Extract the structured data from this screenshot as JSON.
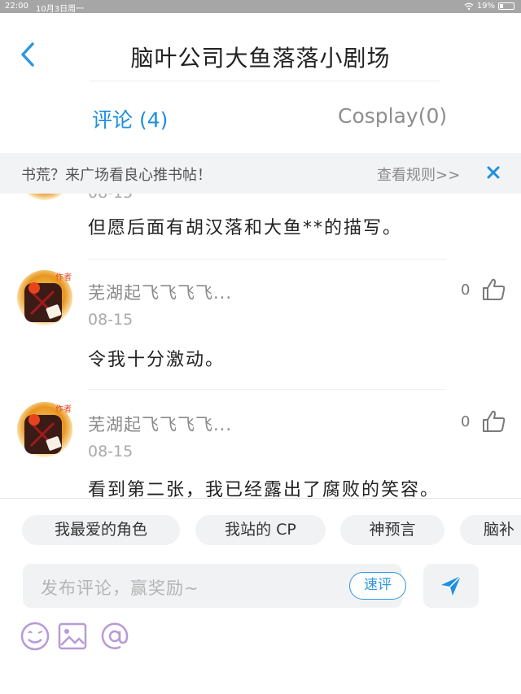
{
  "status_bar": {
    "time": "22:00",
    "date": "10月3日周一",
    "battery": "19%"
  },
  "header": {
    "title": "脑叶公司大鱼落落小剧场"
  },
  "tabs": [
    {
      "label": "评论 (4)",
      "active": true
    },
    {
      "label": "Cosplay(0)",
      "active": false
    }
  ],
  "notice": {
    "text": "书荒？来广场看良心推书帖！",
    "link": "查看规则>>"
  },
  "comments": [
    {
      "date": "08-15",
      "text": "但愿后面有胡汉落和大鱼**的描写。"
    },
    {
      "user": "芜湖起飞飞飞飞...",
      "badge": "作者",
      "date": "08-15",
      "likes": "0",
      "text": "令我十分激动。"
    },
    {
      "user": "芜湖起飞飞飞飞...",
      "badge": "作者",
      "date": "08-15",
      "likes": "0",
      "text": "看到第二张，我已经露出了腐败的笑容。"
    }
  ],
  "composer": {
    "chips": [
      "我最爱的角色",
      "我站的 CP",
      "神预言",
      "脑补"
    ],
    "placeholder": "发布评论，赢奖励~",
    "quick_label": "速评"
  },
  "colors": {
    "accent": "#1d8fe1",
    "chip_bg": "#f1f2f4",
    "tool_purple": "#b89ad6"
  }
}
